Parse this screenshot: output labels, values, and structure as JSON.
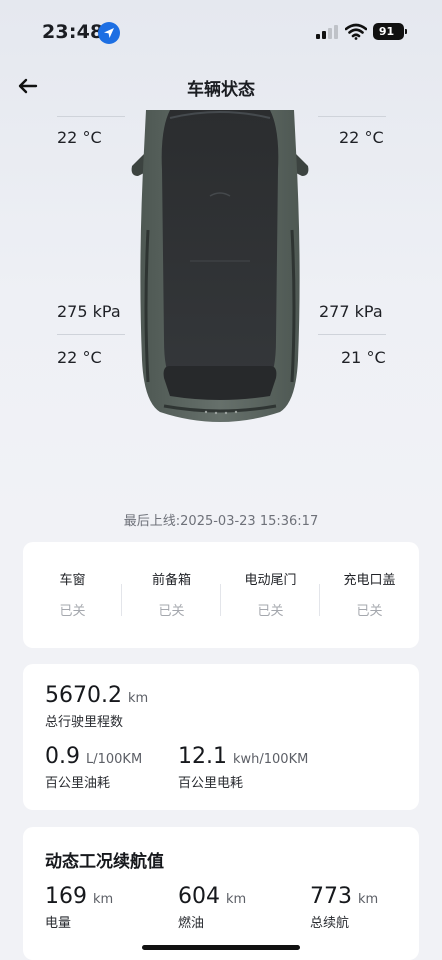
{
  "status_bar": {
    "time": "23:48",
    "battery": "91"
  },
  "header": {
    "title": "车辆状态"
  },
  "tires": {
    "front_left_temp": "22 °C",
    "front_right_temp": "22 °C",
    "rear_left_pressure": "275 kPa",
    "rear_right_pressure": "277 kPa",
    "rear_left_temp": "22 °C",
    "rear_right_temp": "21 °C"
  },
  "last_online": "最后上线:2025-03-23 15:36:17",
  "doors": [
    {
      "label": "车窗",
      "status": "已关"
    },
    {
      "label": "前备箱",
      "status": "已关"
    },
    {
      "label": "电动尾门",
      "status": "已关"
    },
    {
      "label": "充电口盖",
      "status": "已关"
    }
  ],
  "stats": {
    "odometer_value": "5670.2",
    "odometer_unit": "km",
    "odometer_label": "总行驶里程数",
    "fuel_value": "0.9",
    "fuel_unit": "L/100KM",
    "fuel_label": "百公里油耗",
    "elec_value": "12.1",
    "elec_unit": "kwh/100KM",
    "elec_label": "百公里电耗"
  },
  "range": {
    "title": "动态工况续航值",
    "items": [
      {
        "value": "169",
        "unit": "km",
        "label": "电量"
      },
      {
        "value": "604",
        "unit": "km",
        "label": "燃油"
      },
      {
        "value": "773",
        "unit": "km",
        "label": "总续航"
      }
    ]
  },
  "colors": {
    "accent_blue": "#1d6fe3",
    "car_body": "#5e6863",
    "background": "#eef0f5"
  }
}
